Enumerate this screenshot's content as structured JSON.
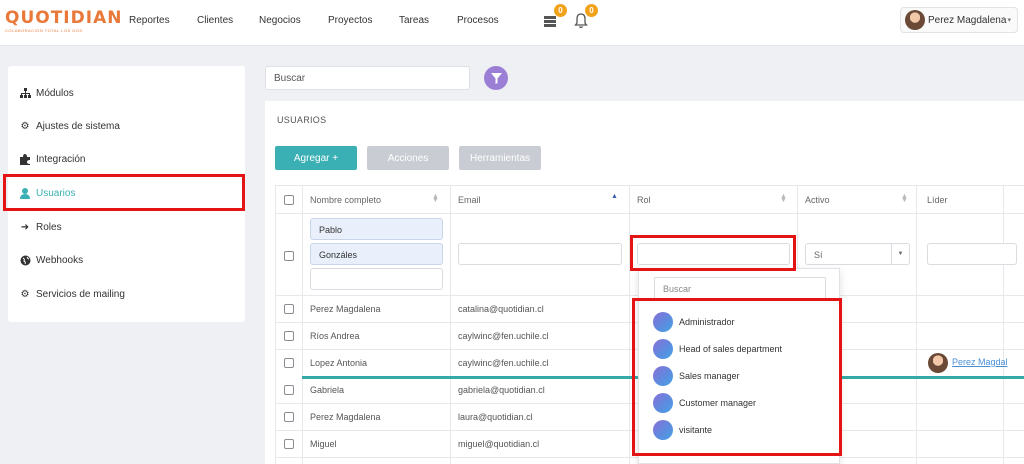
{
  "app": {
    "logo_text": "QUOTIDIAN",
    "logo_tagline": "COLABORACIÓN TOTAL LOS DOS",
    "accent": "#3bb0b4",
    "logo_color": "#e8793a"
  },
  "nav": {
    "items": [
      "Reportes",
      "Clientes",
      "Negocios",
      "Proyectos",
      "Tareas",
      "Procesos"
    ],
    "inbox_badge": "0",
    "bell_badge": "0",
    "user_name": "Perez Magdalena"
  },
  "sidebar": {
    "items": [
      {
        "label": "Módulos",
        "icon": "sitemap-icon"
      },
      {
        "label": "Ajustes de sistema",
        "icon": "gears-icon"
      },
      {
        "label": "Integración",
        "icon": "puzzle-icon"
      },
      {
        "label": "Usuarios",
        "icon": "user-icon",
        "active": true
      },
      {
        "label": "Roles",
        "icon": "arrow-right-icon"
      },
      {
        "label": "Webhooks",
        "icon": "globe-icon"
      },
      {
        "label": "Servicios de mailing",
        "icon": "gear-icon"
      }
    ]
  },
  "search": {
    "placeholder": "Buscar"
  },
  "panel": {
    "title": "USUARIOS",
    "buttons": {
      "add": "Agregar +",
      "actions": "Acciones",
      "tools": "Herramientas"
    }
  },
  "table": {
    "headers": [
      "Nombre completo",
      "Email",
      "Rol",
      "Activo",
      "Líder"
    ],
    "filters": {
      "name_tags": [
        "Pablo",
        "Gonzáles"
      ],
      "activo_value": "Sí"
    },
    "rows": [
      {
        "name": "Perez Magdalena",
        "email": "catalina@quotidian.cl",
        "leader": ""
      },
      {
        "name": "Ríos Andrea",
        "email": "caylwinc@fen.uchile.cl",
        "leader": ""
      },
      {
        "name": "Lopez Antonia",
        "email": "caylwinc@fen.uchile.cl",
        "leader": "Perez Magdal"
      },
      {
        "name": "Gabriela",
        "email": "gabriela@quotidian.cl",
        "leader": ""
      },
      {
        "name": "Perez Magdalena",
        "email": "laura@quotidian.cl",
        "leader": ""
      },
      {
        "name": "Miguel",
        "email": "miguel@quotidian.cl",
        "leader": ""
      }
    ]
  },
  "role_dropdown": {
    "search_placeholder": "Buscar",
    "options": [
      "Administrador",
      "Head of sales department",
      "Sales manager",
      "Customer manager",
      "visitante"
    ]
  }
}
